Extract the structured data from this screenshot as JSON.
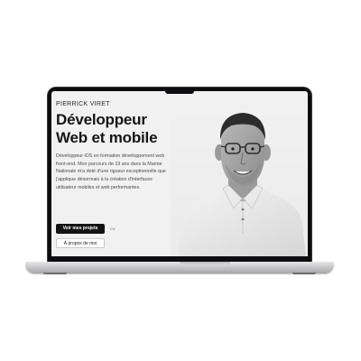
{
  "hero": {
    "eyebrow": "PIERRICK VIRET",
    "headline_line1": "Développeur",
    "headline_line2": "Web et mobile",
    "bio": "Développeur iOS en formation développement web front-end. Mon parcours de 19 ans dans la Marine Nationale m'a doté d'une rigueur exceptionnelle que j'applique désormais à la création d'interfaces utilisateur mobiles et web performantes.",
    "primary_button": "Voir mes projets",
    "secondary_link": "CV",
    "secondary_button": "À propos de moi"
  },
  "colors": {
    "background": "#f1f1f1",
    "primary_button": "#121212",
    "text": "#151515"
  },
  "icons": {
    "portrait": "portrait-photo"
  }
}
